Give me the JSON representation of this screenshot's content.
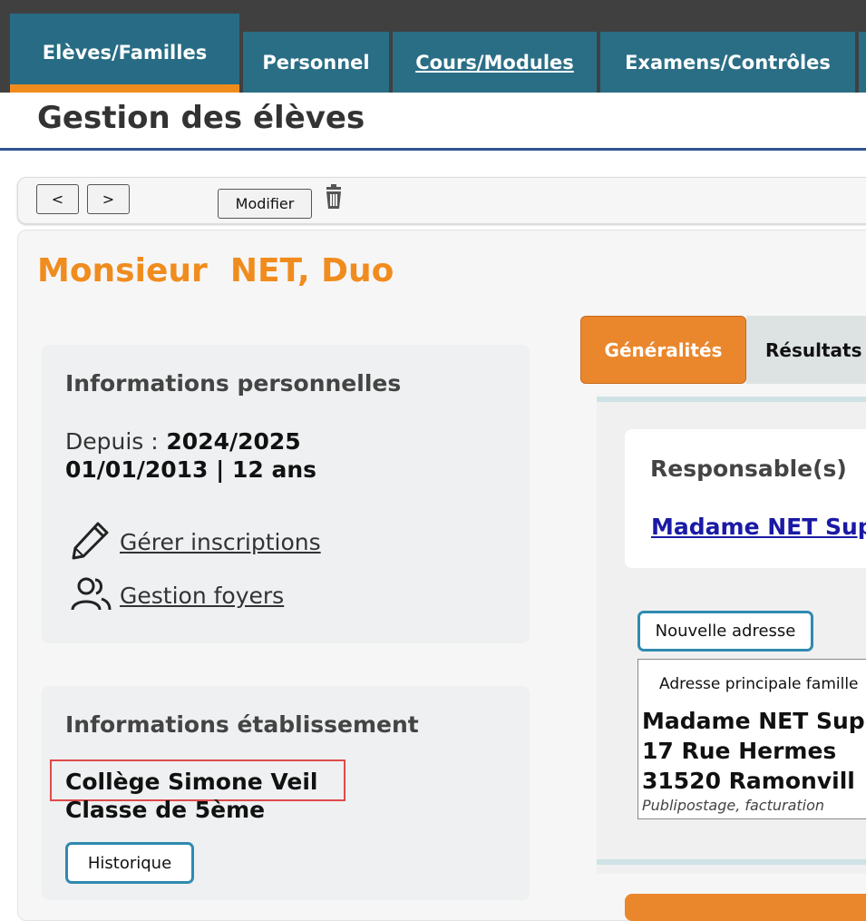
{
  "nav": {
    "tabs": [
      {
        "label": "Elèves/Familles"
      },
      {
        "label": "Personnel"
      },
      {
        "label": "Cours/Modules"
      },
      {
        "label": "Examens/Contrôles"
      }
    ]
  },
  "page_title": "Gestion des élèves",
  "toolbar": {
    "prev_label": "<",
    "next_label": ">",
    "modify_label": "Modifier",
    "delete_icon": "trash-icon"
  },
  "student": {
    "name": "Monsieur  NET, Duo"
  },
  "personal_info": {
    "heading": "Informations personnelles",
    "since_label": "Depuis :",
    "since_value": "2024/2025",
    "birth_line": "01/01/2013 | 12 ans",
    "manage_enrollments": "Gérer inscriptions",
    "manage_households": "Gestion foyers",
    "icons": [
      "pencil-icon",
      "users-icon"
    ]
  },
  "school_info": {
    "heading": "Informations établissement",
    "school": "Collège Simone Veil",
    "class": "Classe de 5ème",
    "history_button": "Historique"
  },
  "right_tabs": [
    {
      "label": "Généralités"
    },
    {
      "label": "Résultats"
    }
  ],
  "responsables": {
    "heading": "Responsable(s)",
    "link": "Madame NET Sup"
  },
  "address": {
    "new_button": "Nouvelle adresse",
    "title": "Adresse principale famille",
    "line1": "Madame NET Sup",
    "line2": "17 Rue Hermes",
    "line3": "31520 Ramonvill",
    "note": "Publipostage, facturation"
  },
  "colors": {
    "nav_bg": "#404040",
    "tab_bg": "#2a6e85",
    "accent_orange": "#f08c1e",
    "title_rule": "#2f5391",
    "button_border": "#2f8ab0",
    "highlight_red": "#e04a4a"
  }
}
